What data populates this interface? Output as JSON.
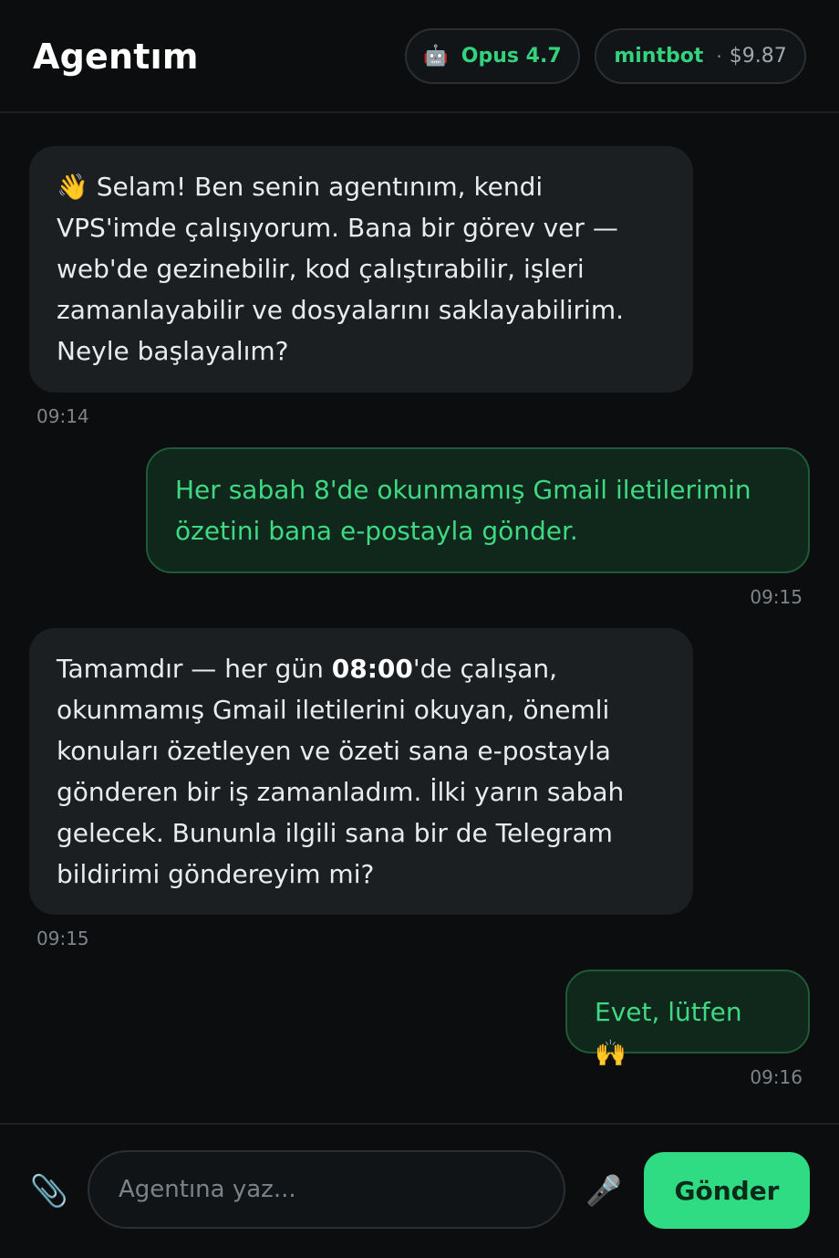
{
  "header": {
    "title": "Agentım",
    "model": {
      "icon": "robot-icon",
      "glyph": "🤖",
      "label": "Opus 4.7"
    },
    "account": {
      "name": "mintbot",
      "separator": "·",
      "balance": "$9.87"
    }
  },
  "messages": [
    {
      "role": "agent",
      "emoji": "👋",
      "text": " Selam! Ben senin agentınım, kendi VPS'imde çalışıyorum. Bana bir görev ver — web'de gezinebilir, kod çalıştırabilir, işleri zamanlayabilir ve dosyalarını saklayabilirim. Neyle başlayalım?",
      "time": "09:14"
    },
    {
      "role": "user",
      "text": "Her sabah 8'de okunmamış Gmail iletilerimin özetini bana e-postayla gönder.",
      "time": "09:15"
    },
    {
      "role": "agent",
      "text_before": "Tamamdır — her gün ",
      "text_bold": "08:00",
      "text_after": "'de çalışan, okunmamış Gmail iletilerini okuyan, önemli konuları özetleyen ve özeti sana e-postayla gönderen bir iş zamanladım. İlki yarın sabah gelecek. Bununla ilgili sana bir de Telegram bildirimi göndereyim mi?",
      "time": "09:15"
    },
    {
      "role": "user",
      "text": "Evet, lütfen 🙌",
      "time": "09:16"
    }
  ],
  "composer": {
    "attach_icon": "paperclip-icon",
    "attach_glyph": "📎",
    "placeholder": "Agentına yaz...",
    "value": "",
    "mic_icon": "microphone-icon",
    "mic_glyph": "🎤",
    "send_label": "Gönder"
  },
  "colors": {
    "background": "#0c0d0e",
    "accent": "#2fdc84",
    "agent_bubble": "#1b1f22",
    "user_bubble": "#10281b",
    "user_text": "#3ed982"
  }
}
